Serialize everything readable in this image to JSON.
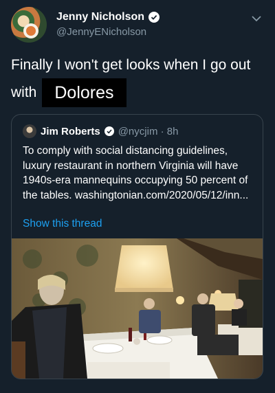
{
  "author": {
    "display_name": "Jenny Nicholson",
    "handle": "@JennyENicholson",
    "avatar_icon": "avatar-image",
    "verified_icon": "verified-badge-icon"
  },
  "tweet": {
    "line1": "Finally I won't get looks when I go out",
    "line2_prefix": "with",
    "line2_highlight": "Dolores"
  },
  "quoted_tweet": {
    "display_name": "Jim Roberts",
    "handle_time": "@nycjim · 8h",
    "text": "To comply with social distancing guidelines, luxury restaurant in northern Virginia will have 1940s-era mannequins occupying 50 percent of the tables. washingtonian.com/2020/05/12/inn...",
    "show_thread": "Show this thread"
  },
  "colors": {
    "background": "#15202b",
    "secondary_text": "#8899a6",
    "link": "#1da1f2",
    "border": "#38444d"
  }
}
